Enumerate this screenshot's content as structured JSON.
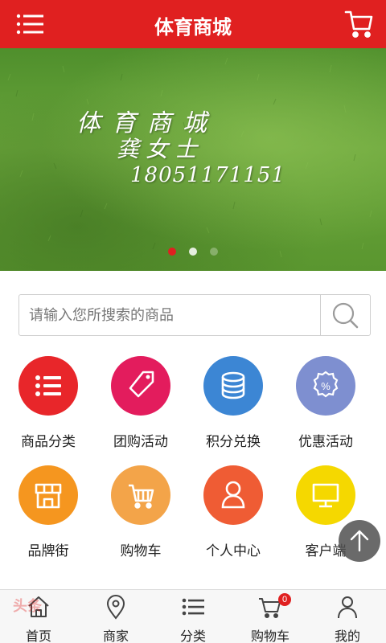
{
  "header": {
    "title": "体育商城",
    "menu_icon": "menu-icon",
    "cart_icon": "cart-icon"
  },
  "banner": {
    "line1": "体育商城",
    "line2": "龚女士",
    "line3": "18051171151",
    "slide_count": 3,
    "active_slide": 1
  },
  "search": {
    "placeholder": "请输入您所搜索的商品",
    "value": "",
    "button_icon": "search-icon"
  },
  "grid": [
    {
      "label": "商品分类",
      "icon": "list-icon",
      "color": "#e8262a"
    },
    {
      "label": "团购活动",
      "icon": "tag-icon",
      "color": "#e31c5d"
    },
    {
      "label": "积分兑换",
      "icon": "coins-icon",
      "color": "#3c86d4"
    },
    {
      "label": "优惠活动",
      "icon": "percent-badge-icon",
      "color": "#7e8fd0"
    },
    {
      "label": "品牌街",
      "icon": "storefront-icon",
      "color": "#f5961f"
    },
    {
      "label": "购物车",
      "icon": "cart-icon",
      "color": "#f3a449"
    },
    {
      "label": "个人中心",
      "icon": "user-icon",
      "color": "#ef5c34"
    },
    {
      "label": "客户端",
      "icon": "monitor-icon",
      "color": "#f5d800"
    }
  ],
  "tabbar": [
    {
      "label": "首页",
      "icon": "home-icon"
    },
    {
      "label": "商家",
      "icon": "location-pin-icon"
    },
    {
      "label": "分类",
      "icon": "list-icon"
    },
    {
      "label": "购物车",
      "icon": "cart-icon",
      "badge": "0"
    },
    {
      "label": "我的",
      "icon": "user-icon"
    }
  ],
  "watermark": "头条",
  "colors": {
    "brand": "#e02020",
    "tab_text": "#222222"
  }
}
